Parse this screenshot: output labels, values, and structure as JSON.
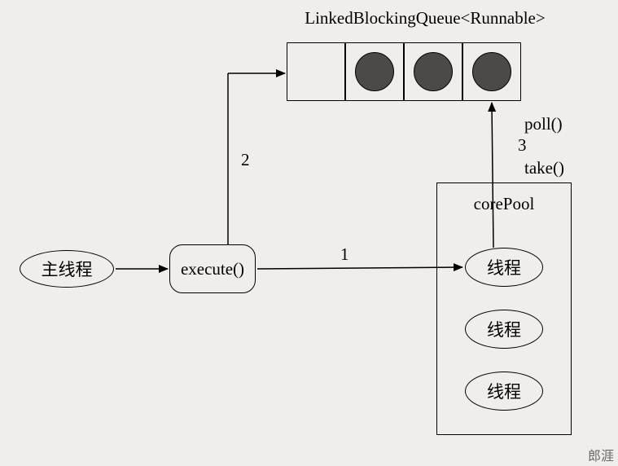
{
  "nodes": {
    "main_thread": "主线程",
    "execute": "execute()",
    "core_pool": "corePool",
    "worker": "线程"
  },
  "queue": {
    "title": "LinkedBlockingQueue<Runnable>",
    "slots_filled": [
      false,
      true,
      true,
      true
    ]
  },
  "edges": {
    "one": "1",
    "two": "2",
    "three": "3",
    "poll": "poll()",
    "take": "take()"
  },
  "watermark": "郎涯"
}
